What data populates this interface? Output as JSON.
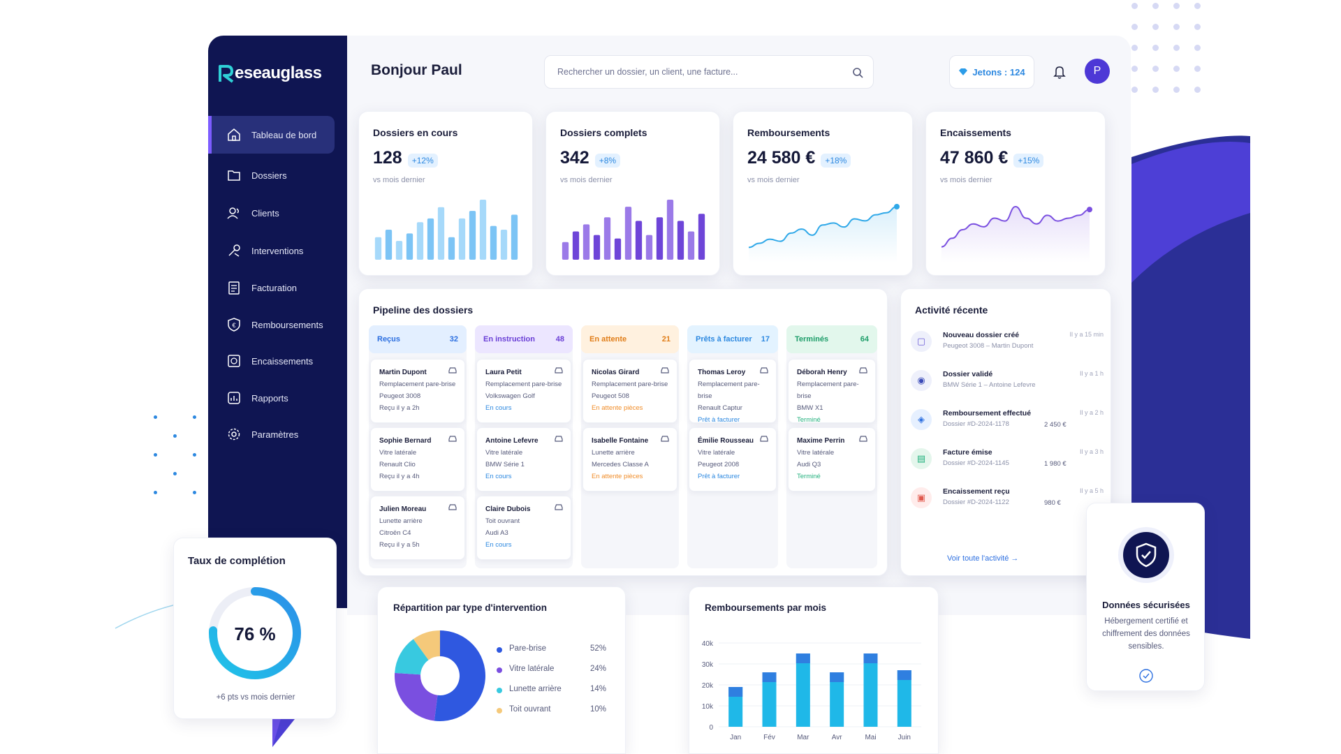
{
  "brand": {
    "name": "eseauglass"
  },
  "header": {
    "greeting": "Bonjour Paul",
    "search_placeholder": "Rechercher un dossier, un client, une facture...",
    "jetons": "Jetons : 124",
    "avatar": "P"
  },
  "sidebar": {
    "items": [
      {
        "label": "Tableau de bord",
        "icon": "home-icon",
        "active": true
      },
      {
        "label": "Dossiers",
        "icon": "folder-icon"
      },
      {
        "label": "Clients",
        "icon": "users-icon"
      },
      {
        "label": "Interventions",
        "icon": "tools-icon"
      },
      {
        "label": "Facturation",
        "icon": "invoice-icon"
      },
      {
        "label": "Remboursements",
        "icon": "shield-euro-icon"
      },
      {
        "label": "Encaissements",
        "icon": "cash-icon"
      },
      {
        "label": "Rapports",
        "icon": "report-icon"
      },
      {
        "label": "Paramètres",
        "icon": "settings-icon"
      }
    ]
  },
  "kpis": [
    {
      "title": "Dossiers en cours",
      "value": "128",
      "delta": "+12%",
      "sub": "vs mois dernier"
    },
    {
      "title": "Dossiers complets",
      "value": "342",
      "delta": "+8%",
      "sub": "vs mois dernier"
    },
    {
      "title": "Remboursements",
      "value": "24 580 €",
      "delta": "+18%",
      "sub": "vs mois dernier"
    },
    {
      "title": "Encaissements",
      "value": "47 860 €",
      "delta": "+15%",
      "sub": "vs mois dernier"
    }
  ],
  "pipeline": {
    "title": "Pipeline des dossiers",
    "columns": [
      {
        "name": "Reçus",
        "count": "32",
        "cards": [
          {
            "name": "Martin Dupont",
            "l1": "Remplacement pare-brise",
            "l2": "Peugeot 3008",
            "l3": "Reçu il y a 2h"
          },
          {
            "name": "Sophie Bernard",
            "l1": "Vitre latérale",
            "l2": "Renault Clio",
            "l3": "Reçu il y a 4h"
          },
          {
            "name": "Julien Moreau",
            "l1": "Lunette arrière",
            "l2": "Citroën C4",
            "l3": "Reçu il y a 5h"
          }
        ]
      },
      {
        "name": "En instruction",
        "count": "48",
        "cards": [
          {
            "name": "Laura Petit",
            "l1": "Remplacement pare-brise",
            "l2": "Volkswagen Golf",
            "l3": "En cours"
          },
          {
            "name": "Antoine Lefevre",
            "l1": "Vitre latérale",
            "l2": "BMW Série 1",
            "l3": "En cours"
          },
          {
            "name": "Claire Dubois",
            "l1": "Toit ouvrant",
            "l2": "Audi A3",
            "l3": "En cours"
          }
        ]
      },
      {
        "name": "En attente",
        "count": "21",
        "cards": [
          {
            "name": "Nicolas Girard",
            "l1": "Remplacement pare-brise",
            "l2": "Peugeot 508",
            "l3": "En attente pièces"
          },
          {
            "name": "Isabelle Fontaine",
            "l1": "Lunette arrière",
            "l2": "Mercedes Classe A",
            "l3": "En attente pièces"
          }
        ]
      },
      {
        "name": "Prêts à facturer",
        "count": "17",
        "cards": [
          {
            "name": "Thomas Leroy",
            "l1": "Remplacement pare-brise",
            "l2": "Renault Captur",
            "l3": "Prêt à facturer"
          },
          {
            "name": "Émilie Rousseau",
            "l1": "Vitre latérale",
            "l2": "Peugeot 2008",
            "l3": "Prêt à facturer"
          }
        ]
      },
      {
        "name": "Terminés",
        "count": "64",
        "cards": [
          {
            "name": "Déborah Henry",
            "l1": "Remplacement pare-brise",
            "l2": "BMW X1",
            "l3": "Terminé"
          },
          {
            "name": "Maxime Perrin",
            "l1": "Vitre latérale",
            "l2": "Audi Q3",
            "l3": "Terminé"
          }
        ]
      }
    ]
  },
  "activity": {
    "title": "Activité récente",
    "items": [
      {
        "title": "Nouveau dossier créé",
        "sub": "Peugeot 3008 – Martin Dupont",
        "time": "Il y a 15 min",
        "amount": ""
      },
      {
        "title": "Dossier validé",
        "sub": "BMW Série 1 – Antoine Lefevre",
        "time": "Il y a 1 h",
        "amount": ""
      },
      {
        "title": "Remboursement effectué",
        "sub": "Dossier #D-2024-1178",
        "time": "Il y a 2 h",
        "amount": "2 450 €"
      },
      {
        "title": "Facture émise",
        "sub": "Dossier #D-2024-1145",
        "time": "Il y a 3 h",
        "amount": "1 980 €"
      },
      {
        "title": "Encaissement reçu",
        "sub": "Dossier #D-2024-1122",
        "time": "Il y a 5 h",
        "amount": "980 €"
      }
    ],
    "link": "Voir toute l'activité"
  },
  "completion": {
    "title": "Taux de complétion",
    "value": "76 %",
    "fraction": 0.76,
    "sub": "+6  pts vs mois dernier"
  },
  "security": {
    "title": "Données sécurisées",
    "text": "Hébergement certifié et chiffrement des données sensibles."
  },
  "chart_data": [
    {
      "type": "pie",
      "title": "Répartition par type d'intervention",
      "labels": [
        "Pare-brise",
        "Vitre latérale",
        "Lunette arrière",
        "Toit ouvrant"
      ],
      "pct_labels": [
        "52%",
        "24%",
        "14%",
        "10%"
      ],
      "values": [
        52,
        24,
        14,
        10
      ],
      "colors": [
        "#2f58e0",
        "#7a4fe0",
        "#38c9e0",
        "#f5c97a"
      ]
    },
    {
      "type": "bar",
      "title": "Remboursements par mois",
      "categories": [
        "Jan",
        "Fév",
        "Mar",
        "Avr",
        "Mai",
        "Juin"
      ],
      "values": [
        19000,
        26000,
        35000,
        26000,
        35000,
        27000
      ],
      "ylim": [
        0,
        40000
      ],
      "yticks": [
        "0",
        "10k",
        "20k",
        "30k",
        "40k"
      ]
    },
    {
      "type": "bar",
      "title": "Dossiers en cours",
      "values": [
        6,
        8,
        5,
        7,
        10,
        11,
        14,
        6,
        11,
        13,
        16,
        9,
        8,
        12
      ]
    },
    {
      "type": "bar",
      "title": "Dossiers complets",
      "values": [
        5,
        8,
        10,
        7,
        12,
        6,
        15,
        11,
        7,
        12,
        17,
        11,
        8,
        13
      ]
    },
    {
      "type": "line",
      "title": "Remboursements",
      "values": [
        4,
        6,
        8,
        7,
        11,
        13,
        10,
        15,
        16,
        14,
        18,
        17,
        20,
        21,
        24
      ]
    },
    {
      "type": "line",
      "title": "Encaissements",
      "values": [
        3,
        6,
        9,
        11,
        10,
        13,
        12,
        17,
        13,
        11,
        14,
        12,
        13,
        14,
        16
      ]
    }
  ]
}
